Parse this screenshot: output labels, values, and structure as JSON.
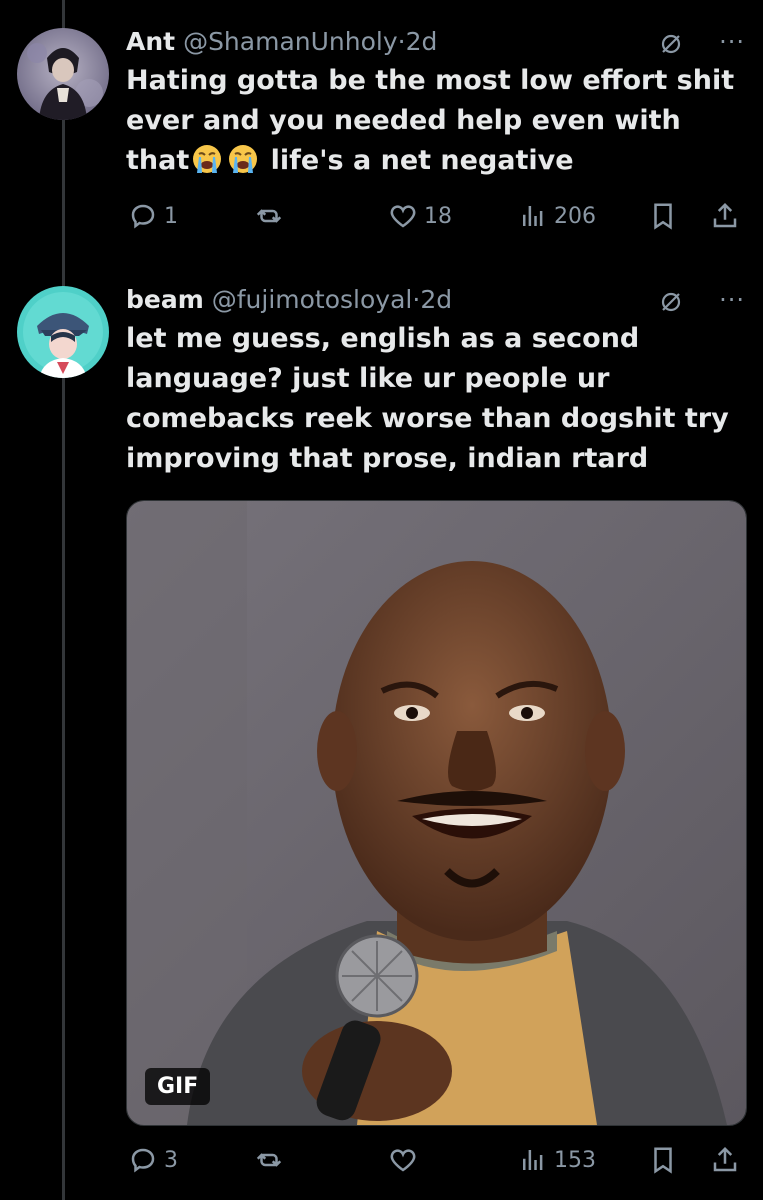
{
  "tweets": [
    {
      "name": "Ant",
      "handle": "@ShamanUnholy",
      "dot": "·",
      "time": "2d",
      "line1": "Hating gotta be the most low effort shit",
      "line2": "ever and you needed help even with",
      "line3_start": "that",
      "line3_end": "life's a net negative",
      "emoji": [
        "crying-face",
        "crying-face"
      ],
      "replies": "1",
      "reposts": "",
      "likes": "18",
      "views": "206"
    },
    {
      "name": "beam",
      "handle": "@fujimotosloyal",
      "dot": "·",
      "time": "2d",
      "lines": [
        "let me guess, english as a second",
        "language? just like ur people ur",
        "comebacks reek worse than dogshit try",
        "improving that prose, indian rtard"
      ],
      "media_badge": "GIF",
      "replies": "3",
      "reposts": "",
      "likes": "",
      "views": "153"
    }
  ],
  "icons": {
    "reply": "reply-icon",
    "repost": "repost-icon",
    "like": "heart-icon",
    "views": "views-icon",
    "bookmark": "bookmark-icon",
    "share": "share-icon",
    "grok": "grok-icon",
    "more": "more-icon"
  },
  "colors": {
    "background": "#000000",
    "text": "#e7e9ea",
    "muted": "#8b98a5",
    "thread_line": "#333639"
  },
  "more_glyph": "···"
}
